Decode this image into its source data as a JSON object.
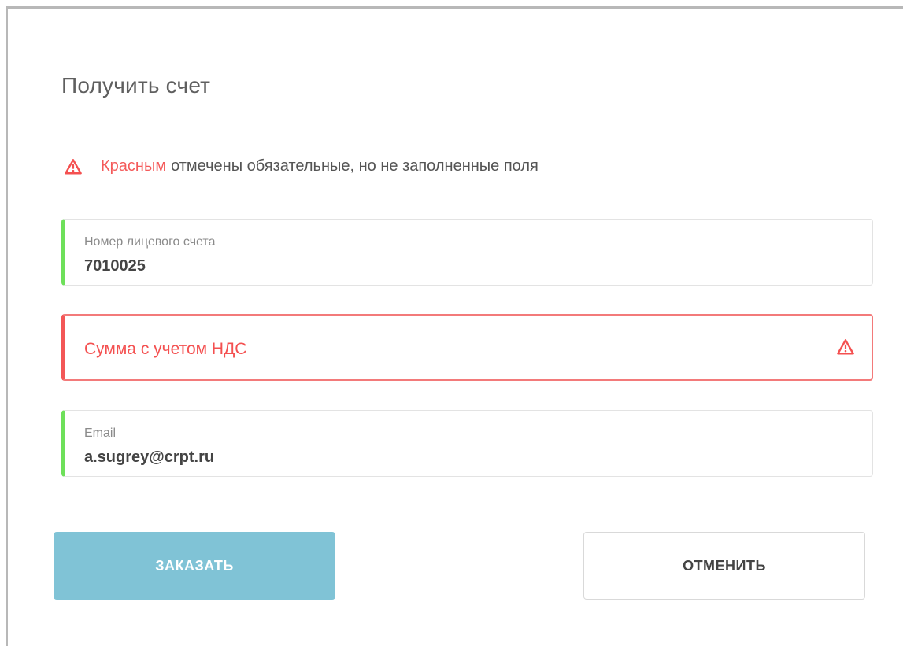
{
  "dialog": {
    "title": "Получить счет"
  },
  "notice": {
    "icon": "warning-triangle-icon",
    "accent_text": "Красным",
    "text": "отмечены обязательные, но не заполненные поля",
    "accent_color": "#f45a5a"
  },
  "fields": {
    "account": {
      "label": "Номер лицевого счета",
      "value": "7010025",
      "status_color": "#6ee05a"
    },
    "amount": {
      "placeholder": "Сумма с учетом НДС",
      "status": "error",
      "icon": "warning-triangle-icon",
      "status_color": "#f35757"
    },
    "email": {
      "label": "Email",
      "value": "a.sugrey@crpt.ru",
      "status_color": "#6ee05a"
    }
  },
  "buttons": {
    "order_label": "ЗАКАЗАТЬ",
    "order_color": "#80c3d6",
    "cancel_label": "ОТМЕНИТЬ"
  }
}
